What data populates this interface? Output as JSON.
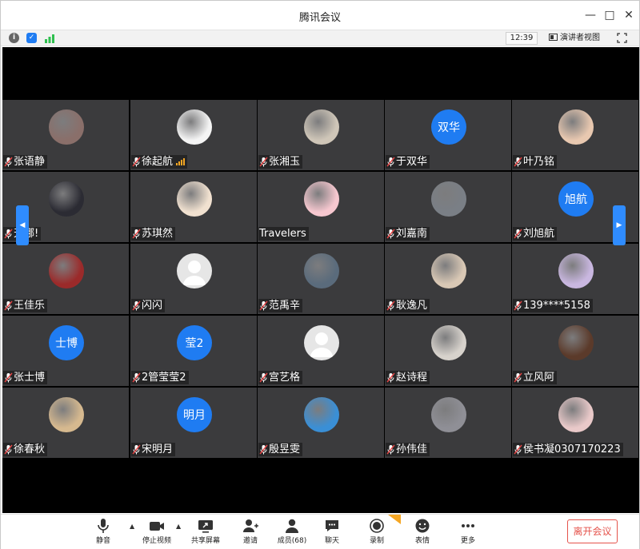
{
  "window": {
    "title": "腾讯会议"
  },
  "infobar": {
    "clock": "12:39",
    "speaker_view_label": "演讲者视图"
  },
  "participants": [
    {
      "name": "张语静",
      "avatar": "photo",
      "color": "#8a6f6a"
    },
    {
      "name": "徐起航",
      "avatar": "photo",
      "color": "#f4f4f4",
      "signal": true
    },
    {
      "name": "张湘玉",
      "avatar": "photo",
      "color": "#cfc6b8"
    },
    {
      "name": "于双华",
      "avatar": "text",
      "avatar_text": "双华"
    },
    {
      "name": "叶乃铭",
      "avatar": "photo",
      "color": "#e8c8b0"
    },
    {
      "name": "天哪!",
      "avatar": "photo",
      "color": "#2b2b33"
    },
    {
      "name": "苏琪然",
      "avatar": "photo",
      "color": "#f1e1d0"
    },
    {
      "name": "Travelers",
      "avatar": "photo",
      "color": "#f6c7cf",
      "no_mic": true
    },
    {
      "name": "刘嘉南",
      "avatar": "photo",
      "color": "#7a7f86"
    },
    {
      "name": "刘旭航",
      "avatar": "text",
      "avatar_text": "旭航"
    },
    {
      "name": "王佳乐",
      "avatar": "photo",
      "color": "#9b2a2a"
    },
    {
      "name": "闪闪",
      "avatar": "grey"
    },
    {
      "name": "范禹辛",
      "avatar": "photo",
      "color": "#5a6b7c"
    },
    {
      "name": "耿逸凡",
      "avatar": "photo",
      "color": "#d9c8b5"
    },
    {
      "name": "139****5158",
      "avatar": "photo",
      "color": "#c9b7e0"
    },
    {
      "name": "张士博",
      "avatar": "text",
      "avatar_text": "士博"
    },
    {
      "name": "2管莹莹2",
      "avatar": "text",
      "avatar_text": "莹2"
    },
    {
      "name": "宫艺格",
      "avatar": "grey"
    },
    {
      "name": "赵诗程",
      "avatar": "photo",
      "color": "#d7d2cc"
    },
    {
      "name": "立风阿",
      "avatar": "photo",
      "color": "#5b3a2a"
    },
    {
      "name": "徐春秋",
      "avatar": "photo",
      "color": "#d6b98f"
    },
    {
      "name": "宋明月",
      "avatar": "text",
      "avatar_text": "明月"
    },
    {
      "name": "殷昱雯",
      "avatar": "photo",
      "color": "#3a8fd6"
    },
    {
      "name": "孙伟佳",
      "avatar": "photo",
      "color": "#8f8f96"
    },
    {
      "name": "侯书凝0307170223",
      "avatar": "photo",
      "color": "#e9c9c9"
    }
  ],
  "toolbar": {
    "mute": "静音",
    "stop_video": "停止视频",
    "share_screen": "共享屏幕",
    "invite": "邀请",
    "members": "成员(68)",
    "chat": "聊天",
    "record": "录制",
    "reactions": "表情",
    "more": "更多",
    "leave": "离开会议"
  },
  "colors": {
    "accent": "#1f7cf2",
    "tile_bg": "#3b3b3d",
    "leave_red": "#e5534b"
  }
}
